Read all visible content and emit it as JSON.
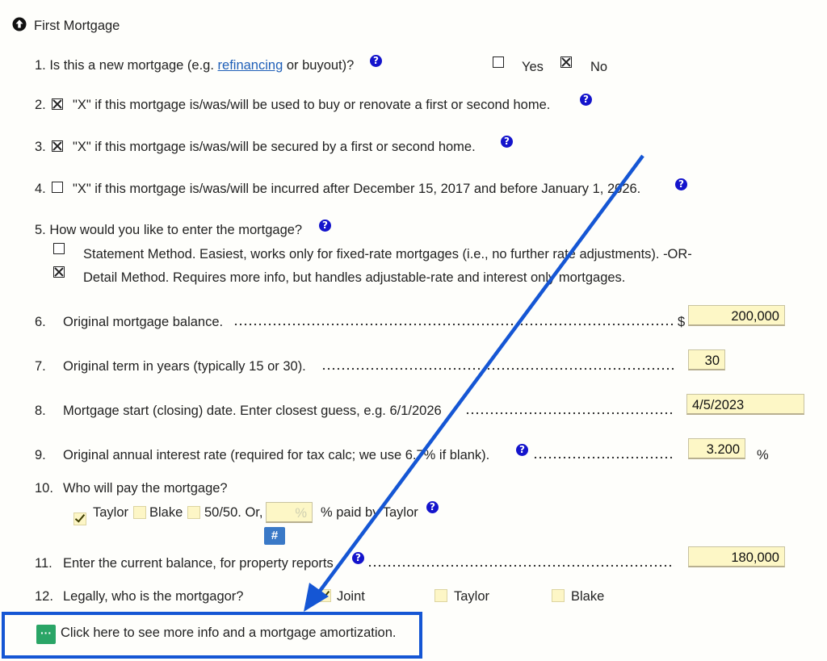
{
  "section": {
    "title": "First Mortgage"
  },
  "q1": {
    "prefix": "1. Is this a new mortgage (e.g. ",
    "link": "refinancing",
    "suffix": " or buyout)?",
    "yes": "Yes",
    "no": "No"
  },
  "q2": {
    "num": "2.",
    "text": "\"X\" if this mortgage is/was/will be used to buy or renovate a first or second home."
  },
  "q3": {
    "num": "3.",
    "text": "\"X\" if this mortgage is/was/will be secured by a first or second home."
  },
  "q4": {
    "num": "4.",
    "text": "\"X\" if this mortgage is/was/will be incurred after December 15, 2017 and before January 1, 2026."
  },
  "q5": {
    "text": "5. How would you like to enter the mortgage?",
    "opt1": "Statement Method. Easiest, works only for fixed-rate mortgages (i.e., no further rate adjustments). -OR-",
    "opt2": "Detail Method. Requires more info, but handles adjustable-rate and interest only mortgages."
  },
  "q6": {
    "num": "6.",
    "label": "Original mortgage balance.",
    "currency": "$",
    "value": "200,000"
  },
  "q7": {
    "num": "7.",
    "label": "Original term in years (typically 15 or 30).",
    "value": "30"
  },
  "q8": {
    "num": "8.",
    "label": "Mortgage start (closing) date. Enter closest guess, e.g. 6/1/2026",
    "value": "4/5/2023"
  },
  "q9": {
    "num": "9.",
    "label": "Original annual interest rate (required for tax calc; we use 6.7% if blank).",
    "value": "3.200",
    "unit": "%"
  },
  "q10": {
    "num": "10.",
    "label": "Who will pay the mortgage?",
    "taylor": "Taylor",
    "blake": "Blake",
    "split": "50/50. Or,",
    "pct_placeholder": "%",
    "pct_label": "% paid by Taylor",
    "hash": "#"
  },
  "q11": {
    "num": "11.",
    "label": "Enter the current balance, for property reports",
    "value": "180,000"
  },
  "q12": {
    "num": "12.",
    "label": "Legally, who is the mortgagor?",
    "joint": "Joint",
    "taylor": "Taylor",
    "blake": "Blake"
  },
  "more": {
    "button": "···",
    "text": "Click here to see more info and a mortgage amortization."
  },
  "colors": {
    "help": "#1414cc",
    "field_bg": "#fdf7c6",
    "annotation": "#1556d4",
    "link": "#1f5fb8"
  }
}
